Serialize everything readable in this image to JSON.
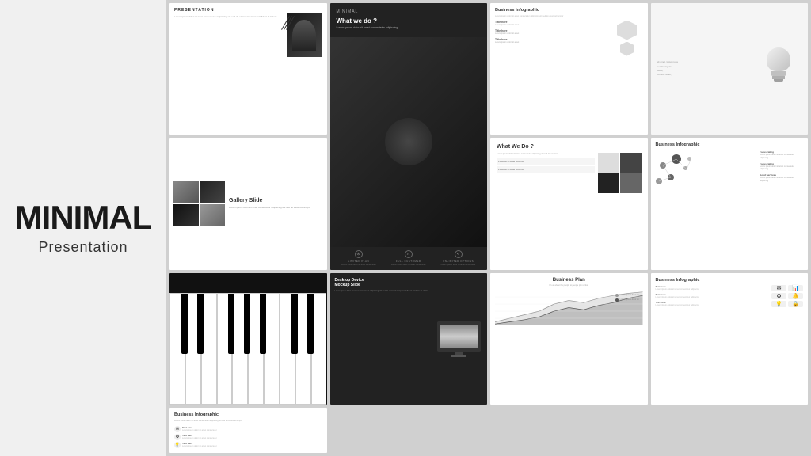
{
  "title": {
    "main": "MINIMAL",
    "sub": "Presentation"
  },
  "slides": [
    {
      "id": 1,
      "type": "presentation-header",
      "label": "PRESENTATION",
      "body_text": "Lorem ipsum dolor sit amet consectetur adipiscing elit sed do eiusmod tempor incididunt ut labore et dolore magna aliqua."
    },
    {
      "id": 2,
      "type": "what-we-do-dark",
      "title": "What we do ?",
      "subtitle": "Lorem ipsum dolor sit amet consectetur",
      "icons": [
        {
          "label": "LIMITED PLAN",
          "desc": "Lorem ipsum dolor sit amet consectetur adipiscing"
        },
        {
          "label": "FULL CUSTOMER",
          "desc": "Lorem ipsum dolor sit amet consectetur adipiscing"
        },
        {
          "label": "UNLIMITED OPTIONS",
          "desc": "Lorem ipsum dolor sit amet consectetur adipiscing"
        }
      ]
    },
    {
      "id": 3,
      "type": "business-infographic-1",
      "title": "Business Infographic",
      "items": [
        {
          "title": "Title here",
          "desc": "Lorem ipsum dolor sit amet consectetur"
        },
        {
          "title": "Title here",
          "desc": "Lorem ipsum dolor sit amet consectetur"
        },
        {
          "title": "Title here",
          "desc": "Lorem ipsum dolor sit amet consectetur"
        }
      ]
    },
    {
      "id": 4,
      "type": "lightbulb",
      "text": "sit amet, lacus nulla porttitor ligula lacus, porttitor dolor;"
    },
    {
      "id": 5,
      "type": "gallery",
      "title": "Gallery Slide",
      "desc": "Lorem ipsum dolor sit amet consectetur adipiscing elit sed do eiusmod tempor"
    },
    {
      "id": 6,
      "type": "what-we-do-light",
      "title": "What We Do ?",
      "text": "Lorem ipsum dolor sit amet consectetur",
      "labels": [
        "LOREM IPSUM DOLOR",
        "LOREM IPSUM DOLOR"
      ]
    },
    {
      "id": 7,
      "type": "business-infographic-dots",
      "title": "Business Infographic",
      "items": [
        {
          "label": "Focus rating",
          "desc": "Lorem ipsum dolor sit amet consectetur adipiscing"
        },
        {
          "label": "Focus rating",
          "desc": "Lorem ipsum dolor sit amet consectetur adipiscing"
        },
        {
          "label": "Good Services",
          "desc": "Lorem ipsum dolor sit amet consectetur adipiscing"
        }
      ]
    },
    {
      "id": 8,
      "type": "piano",
      "keys": 10
    },
    {
      "id": 9,
      "type": "desktop-mockup",
      "title": "Desktop Device Mockup Slide",
      "desc": "Lorem ipsum dolor sit amet consectetur adipiscing elit sed do eiusmod tempor incididunt"
    },
    {
      "id": 10,
      "type": "business-plan",
      "title": "Business Plan",
      "subtitle": "It's all about the people to people plan action",
      "legend": [
        {
          "label": "Lorem ipsum dolor sit",
          "color": "#999"
        },
        {
          "label": "Lorem ipsum dolor sit",
          "color": "#555"
        }
      ]
    },
    {
      "id": 11,
      "type": "business-infographic-icons",
      "title": "Business Infographic",
      "items": [
        {
          "label": "Text here",
          "desc": "Lorem ipsum dolor sit amet consectetur"
        },
        {
          "label": "Text here",
          "desc": "Lorem ipsum dolor sit amet consectetur"
        },
        {
          "label": "Text here",
          "desc": "Lorem ipsum dolor sit amet consectetur"
        }
      ]
    },
    {
      "id": 12,
      "type": "business-infographic-list",
      "title": "Business Infographic",
      "desc": "Lorem ipsum dolor sit amet consectetur adipiscing elit",
      "items": [
        {
          "label": "Text here",
          "desc": "Lorem ipsum dolor sit amet"
        },
        {
          "label": "Text here",
          "desc": "Lorem ipsum dolor sit amet"
        },
        {
          "label": "Text here",
          "desc": "Lorem ipsum dolor sit amet"
        }
      ]
    }
  ]
}
